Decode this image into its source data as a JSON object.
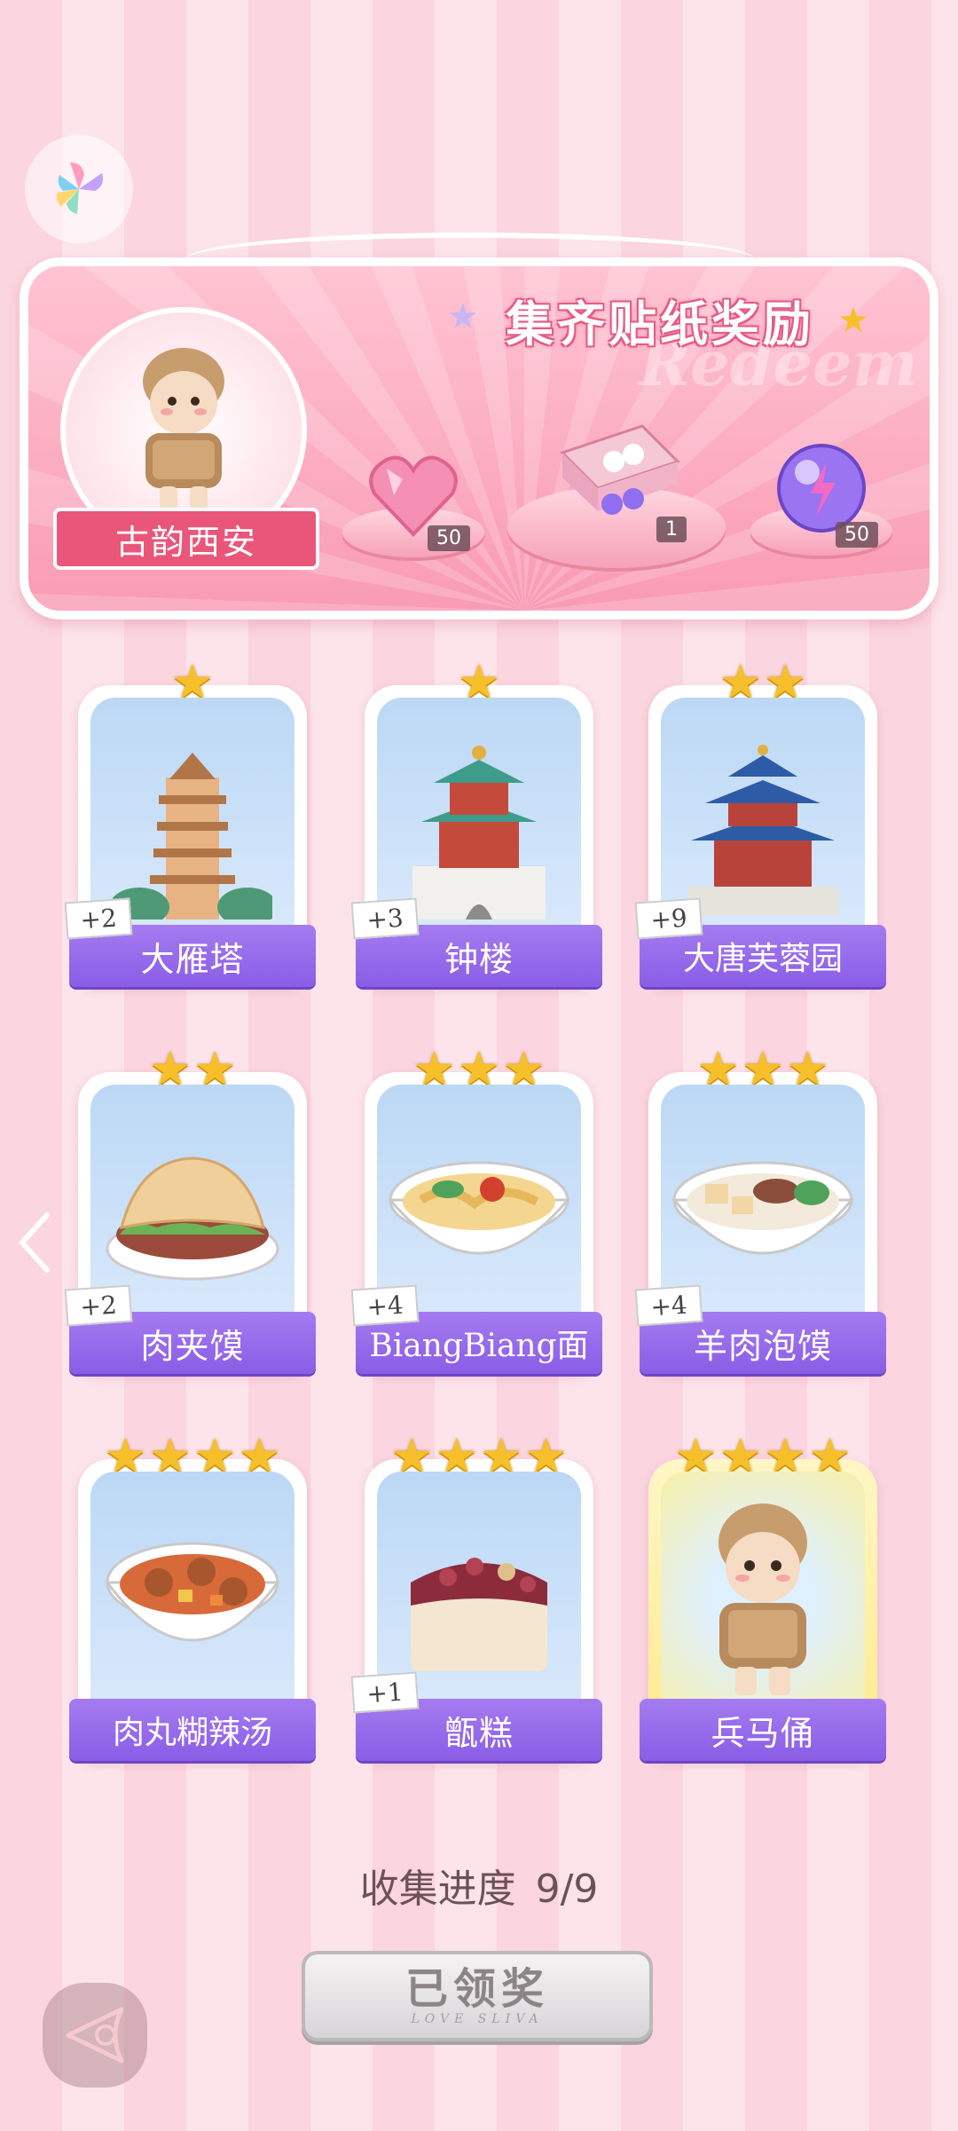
{
  "reward_panel": {
    "title": "集齐贴纸奖励",
    "watermark": "Redeem",
    "avatar_label": "古韵西安",
    "rewards": [
      {
        "icon": "pink-heart-gem-icon",
        "count": "50"
      },
      {
        "icon": "gift-box-icon",
        "count": "1"
      },
      {
        "icon": "purple-energy-orb-icon",
        "count": "50"
      }
    ]
  },
  "cards": [
    {
      "label": "大雁塔",
      "stars": 1,
      "plus": "+2",
      "icon": "pagoda-icon"
    },
    {
      "label": "钟楼",
      "stars": 1,
      "plus": "+3",
      "icon": "bell-tower-icon"
    },
    {
      "label": "大唐芙蓉园",
      "stars": 2,
      "plus": "+9",
      "icon": "pavilion-icon"
    },
    {
      "label": "肉夹馍",
      "stars": 2,
      "plus": "+2",
      "icon": "roujiamo-icon"
    },
    {
      "label": "BiangBiang面",
      "stars": 3,
      "plus": "+4",
      "icon": "noodles-icon"
    },
    {
      "label": "羊肉泡馍",
      "stars": 3,
      "plus": "+4",
      "icon": "mutton-soup-icon"
    },
    {
      "label": "肉丸糊辣汤",
      "stars": 4,
      "plus": "",
      "icon": "meatball-soup-icon"
    },
    {
      "label": "甑糕",
      "stars": 4,
      "plus": "+1",
      "icon": "zenggao-cake-icon"
    },
    {
      "label": "兵马俑",
      "stars": 4,
      "plus": "",
      "icon": "terracotta-warrior-icon",
      "gold": true
    }
  ],
  "progress": {
    "label": "收集进度",
    "value": "9/9"
  },
  "claim_button": {
    "label": "已领奖",
    "sub": "LOVE SLIVA"
  },
  "colors": {
    "accent_purple": "#8a5de6",
    "panel_pink": "#f99bb4",
    "star_gold": "#f7c02a"
  }
}
